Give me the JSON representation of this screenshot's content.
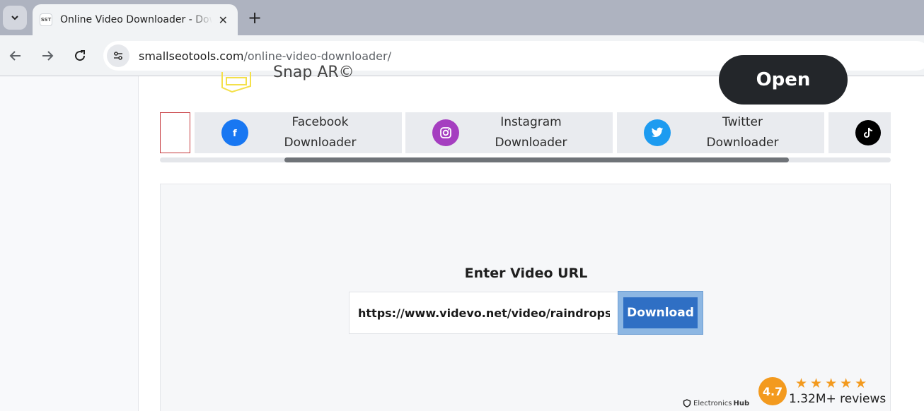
{
  "browser": {
    "tab_title": "Online Video Downloader - Download",
    "favicon_text": "SST",
    "url_host": "smallseotools.com",
    "url_path": "/online-video-downloader/"
  },
  "banner": {
    "snap_text": "Snap AR©",
    "open_label": "Open"
  },
  "downloader_cards": [
    {
      "icon": "facebook-icon",
      "line1": "Facebook",
      "line2": "Downloader",
      "color": "#1877f2"
    },
    {
      "icon": "instagram-icon",
      "line1": "Instagram",
      "line2": "Downloader",
      "color": "#a53ec0"
    },
    {
      "icon": "twitter-icon",
      "line1": "Twitter",
      "line2": "Downloader",
      "color": "#1d9bf0"
    },
    {
      "icon": "tiktok-icon",
      "line1": "",
      "line2": "",
      "color": "#000000"
    }
  ],
  "scroll": {
    "position_fraction": 0.17,
    "visible_fraction": 0.69
  },
  "form": {
    "title": "Enter Video URL",
    "url_value": "https://www.videvo.net/video/raindrops-in-su",
    "download_label": "Download"
  },
  "rating": {
    "score": "4.7",
    "stars": 5,
    "reviews": "1.32M+ reviews",
    "brand_left": "Electronics",
    "brand_right": "Hub"
  }
}
